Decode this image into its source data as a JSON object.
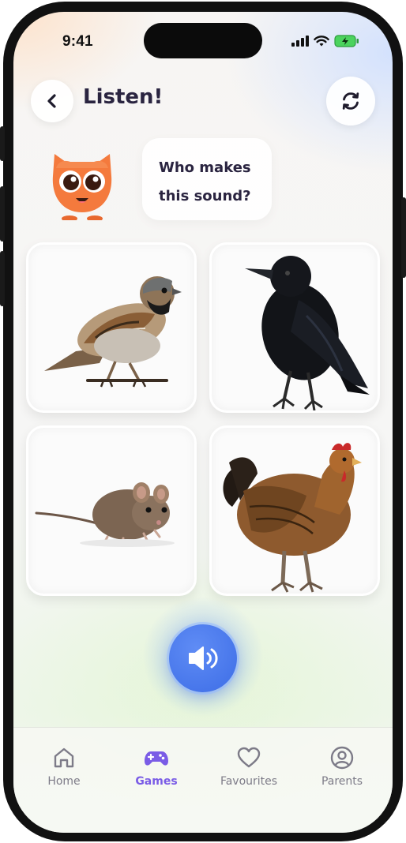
{
  "status_bar": {
    "time": "9:41"
  },
  "header": {
    "title": "Listen!"
  },
  "prompt": {
    "line1": "Who makes",
    "line2": "this sound?"
  },
  "choices": [
    {
      "animal": "sparrow",
      "icon": "sparrow-image"
    },
    {
      "animal": "crow",
      "icon": "crow-image"
    },
    {
      "animal": "mouse",
      "icon": "mouse-image"
    },
    {
      "animal": "hen",
      "icon": "hen-image"
    }
  ],
  "tabs": [
    {
      "label": "Home",
      "icon": "home-icon",
      "active": false
    },
    {
      "label": "Games",
      "icon": "gamepad-icon",
      "active": true
    },
    {
      "label": "Favourites",
      "icon": "heart-icon",
      "active": false
    },
    {
      "label": "Parents",
      "icon": "user-circle-icon",
      "active": false
    }
  ],
  "colors": {
    "accent": "#7a5ce6",
    "sound_button": "#4a78ea",
    "mascot": "#f47a3d",
    "text_dark": "#2a2440"
  }
}
